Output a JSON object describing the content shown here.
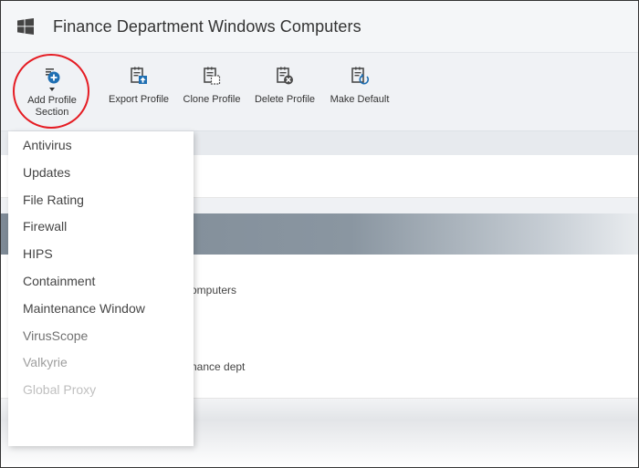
{
  "header": {
    "title": "Finance Department Windows Computers",
    "logo_icon": "windows-logo-icon"
  },
  "toolbar": {
    "items": [
      {
        "label": "Add Profile\nSection",
        "icon": "add-section-icon"
      },
      {
        "label": "Export Profile",
        "icon": "export-icon"
      },
      {
        "label": "Clone Profile",
        "icon": "clone-icon"
      },
      {
        "label": "Delete Profile",
        "icon": "delete-icon"
      },
      {
        "label": "Make Default",
        "icon": "make-default-icon"
      }
    ],
    "accent_color": "#1f6fb2",
    "highlight_color": "#e51c23"
  },
  "dropdown": {
    "items": [
      {
        "label": "Antivirus"
      },
      {
        "label": "Updates"
      },
      {
        "label": "File Rating"
      },
      {
        "label": "Firewall"
      },
      {
        "label": "HIPS"
      },
      {
        "label": "Containment"
      },
      {
        "label": "Maintenance Window"
      },
      {
        "label": "VirusScope"
      },
      {
        "label": "Valkyrie"
      },
      {
        "label": "Global Proxy"
      }
    ]
  },
  "background": {
    "text1": "omputers",
    "text2": "nance dept"
  }
}
